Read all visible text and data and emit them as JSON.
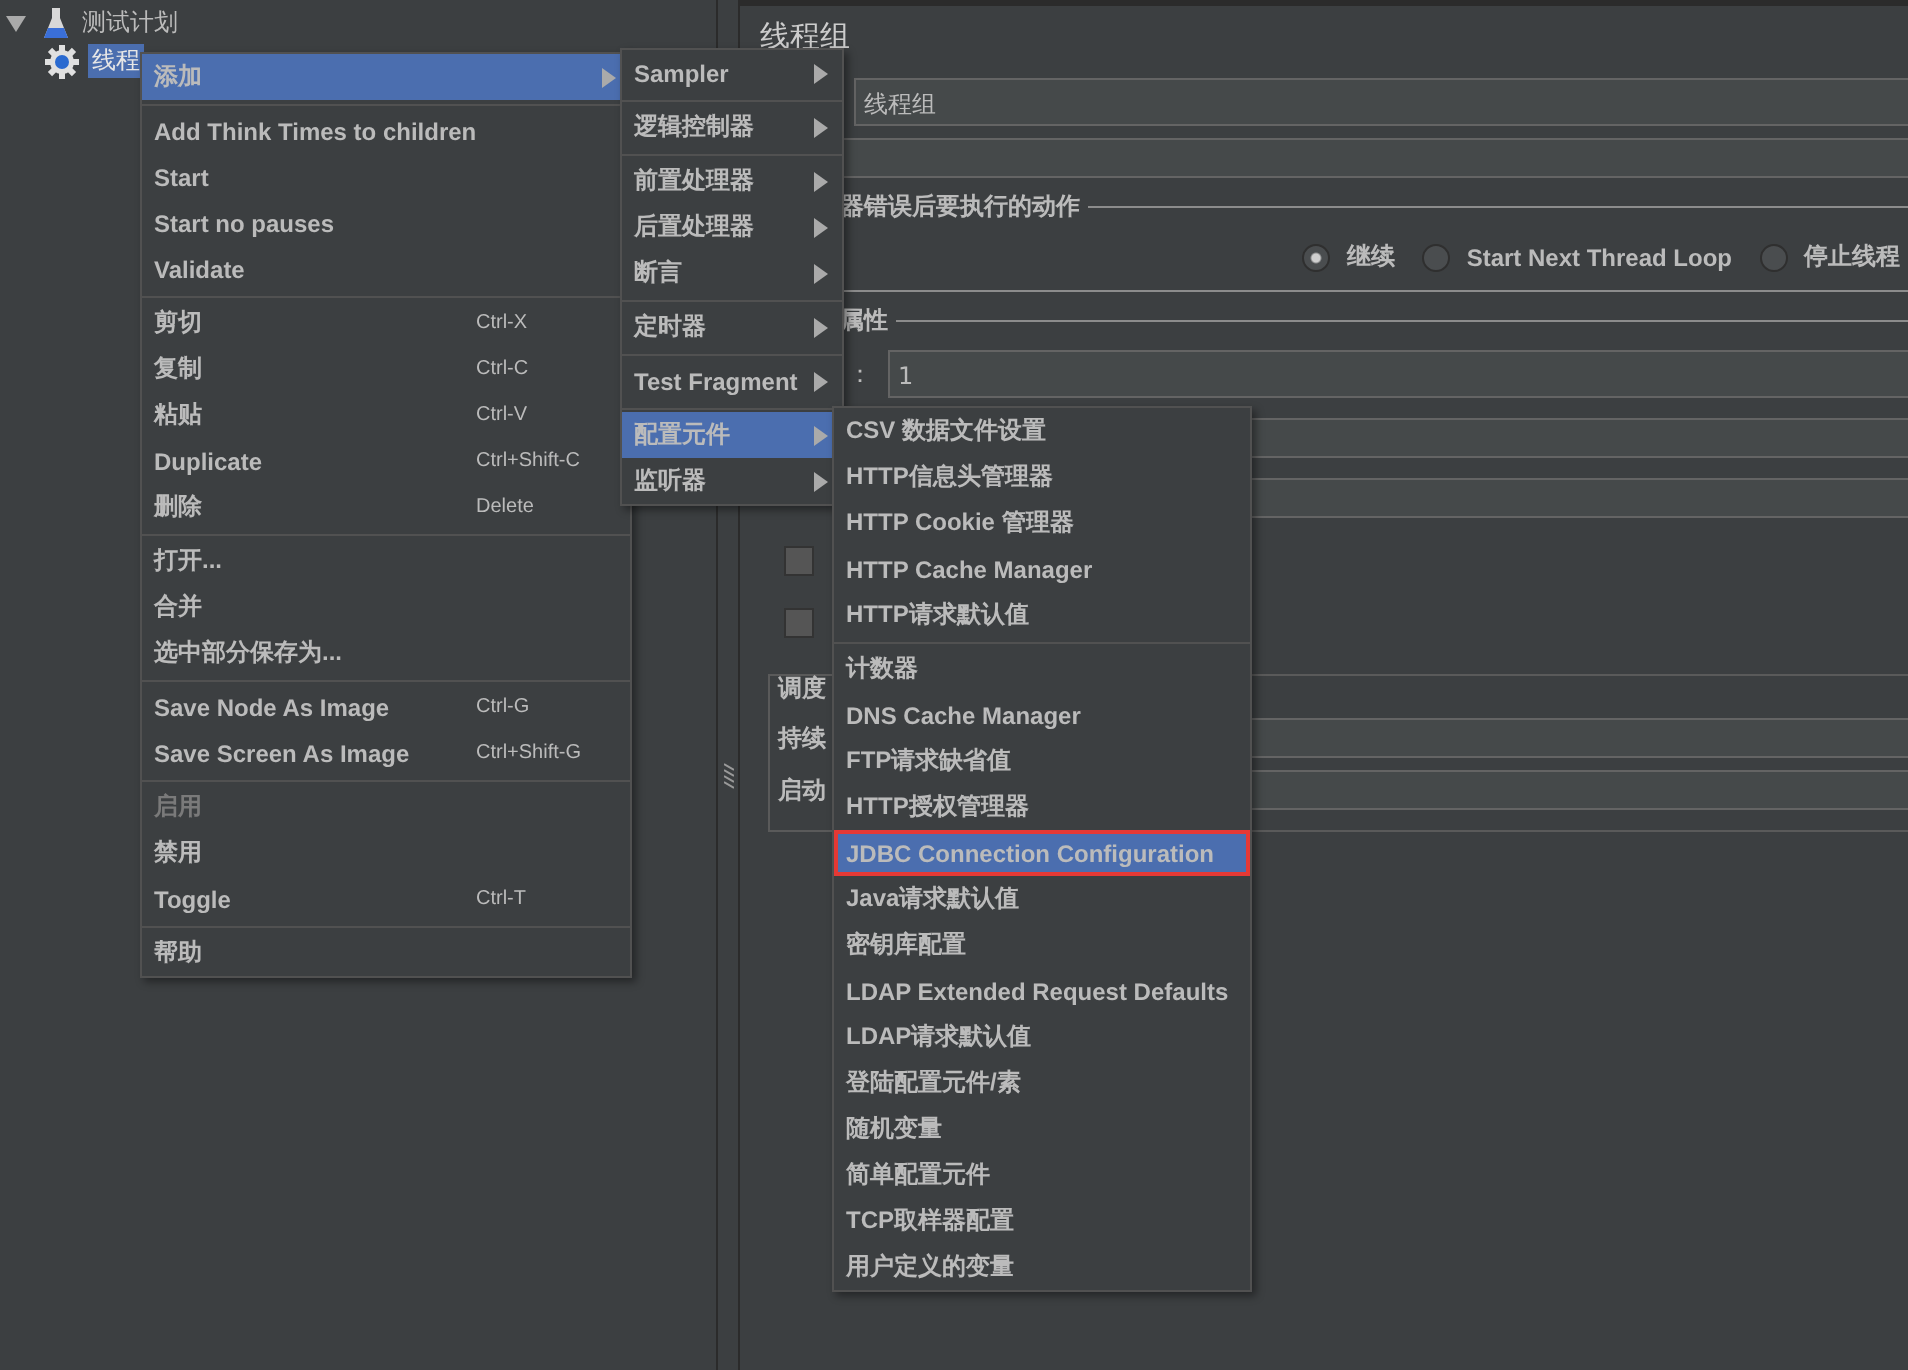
{
  "tree": [
    {
      "label": "测试计划",
      "expanded": true,
      "selected": false,
      "children": [
        {
          "label": "线程",
          "selected": true
        }
      ]
    }
  ],
  "panel": {
    "title": "线程组",
    "name_value": "线程组",
    "error_section": "器错误后要执行的动作",
    "error_actions": [
      {
        "label": "继续",
        "selected": true
      },
      {
        "label": "Start Next Thread Loop",
        "selected": false
      },
      {
        "label": "停止线程",
        "selected": false
      }
    ],
    "props_section": "属性",
    "props_label": "：",
    "threads_value": "1",
    "checkboxes": [
      {
        "checked": false
      },
      {
        "checked": false
      }
    ],
    "sched_section": "调度",
    "sched_labels": [
      "持续",
      "启动"
    ]
  },
  "context_menu": {
    "groups": [
      [
        {
          "label": "添加",
          "submenu": true,
          "selected": true,
          "disabled": false
        }
      ],
      [
        {
          "label": "Add Think Times to children",
          "submenu": false,
          "selected": false,
          "disabled": false
        },
        {
          "label": "Start",
          "submenu": false,
          "selected": false,
          "disabled": false
        },
        {
          "label": "Start no pauses",
          "submenu": false,
          "selected": false,
          "disabled": false
        },
        {
          "label": "Validate",
          "submenu": false,
          "selected": false,
          "disabled": false
        }
      ],
      [
        {
          "label": "剪切",
          "shortcut": "Ctrl-X",
          "submenu": false,
          "selected": false,
          "disabled": false
        },
        {
          "label": "复制",
          "shortcut": "Ctrl-C",
          "submenu": false,
          "selected": false,
          "disabled": false
        },
        {
          "label": "粘贴",
          "shortcut": "Ctrl-V",
          "submenu": false,
          "selected": false,
          "disabled": false
        },
        {
          "label": "Duplicate",
          "shortcut": "Ctrl+Shift-C",
          "submenu": false,
          "selected": false,
          "disabled": false
        },
        {
          "label": "删除",
          "shortcut": "Delete",
          "submenu": false,
          "selected": false,
          "disabled": false
        }
      ],
      [
        {
          "label": "打开...",
          "submenu": false,
          "selected": false,
          "disabled": false
        },
        {
          "label": "合并",
          "submenu": false,
          "selected": false,
          "disabled": false
        },
        {
          "label": "选中部分保存为...",
          "submenu": false,
          "selected": false,
          "disabled": false
        }
      ],
      [
        {
          "label": "Save Node As Image",
          "shortcut": "Ctrl-G",
          "submenu": false,
          "selected": false,
          "disabled": false
        },
        {
          "label": "Save Screen As Image",
          "shortcut": "Ctrl+Shift-G",
          "submenu": false,
          "selected": false,
          "disabled": false
        }
      ],
      [
        {
          "label": "启用",
          "submenu": false,
          "selected": false,
          "disabled": true
        },
        {
          "label": "禁用",
          "submenu": false,
          "selected": false,
          "disabled": false
        },
        {
          "label": "Toggle",
          "shortcut": "Ctrl-T",
          "submenu": false,
          "selected": false,
          "disabled": false
        }
      ],
      [
        {
          "label": "帮助",
          "submenu": false,
          "selected": false,
          "disabled": false
        }
      ]
    ]
  },
  "add_menu": {
    "groups": [
      [
        {
          "label": "Sampler",
          "submenu": true,
          "selected": false
        }
      ],
      [
        {
          "label": "逻辑控制器",
          "submenu": true,
          "selected": false
        }
      ],
      [
        {
          "label": "前置处理器",
          "submenu": true,
          "selected": false
        },
        {
          "label": "后置处理器",
          "submenu": true,
          "selected": false
        },
        {
          "label": "断言",
          "submenu": true,
          "selected": false
        }
      ],
      [
        {
          "label": "定时器",
          "submenu": true,
          "selected": false
        }
      ],
      [
        {
          "label": "Test Fragment",
          "submenu": true,
          "selected": false
        }
      ],
      [
        {
          "label": "配置元件",
          "submenu": true,
          "selected": true
        },
        {
          "label": "监听器",
          "submenu": true,
          "selected": false
        }
      ]
    ]
  },
  "config_menu": {
    "groups": [
      [
        {
          "label": "CSV 数据文件设置",
          "selected": false,
          "annotated": false
        },
        {
          "label": "HTTP信息头管理器",
          "selected": false,
          "annotated": false
        },
        {
          "label": "HTTP Cookie 管理器",
          "selected": false,
          "annotated": false
        },
        {
          "label": "HTTP Cache Manager",
          "selected": false,
          "annotated": false
        },
        {
          "label": "HTTP请求默认值",
          "selected": false,
          "annotated": false
        }
      ],
      [
        {
          "label": "计数器",
          "selected": false,
          "annotated": false
        },
        {
          "label": "DNS Cache Manager",
          "selected": false,
          "annotated": false
        },
        {
          "label": "FTP请求缺省值",
          "selected": false,
          "annotated": false
        },
        {
          "label": "HTTP授权管理器",
          "selected": false,
          "annotated": false
        },
        {
          "label": "JDBC Connection Configuration",
          "selected": true,
          "annotated": true
        },
        {
          "label": "Java请求默认值",
          "selected": false,
          "annotated": false
        },
        {
          "label": "密钥库配置",
          "selected": false,
          "annotated": false
        },
        {
          "label": "LDAP Extended Request Defaults",
          "selected": false,
          "annotated": false
        },
        {
          "label": "LDAP请求默认值",
          "selected": false,
          "annotated": false
        },
        {
          "label": "登陆配置元件/素",
          "selected": false,
          "annotated": false
        },
        {
          "label": "随机变量",
          "selected": false,
          "annotated": false
        },
        {
          "label": "简单配置元件",
          "selected": false,
          "annotated": false
        },
        {
          "label": "TCP取样器配置",
          "selected": false,
          "annotated": false
        },
        {
          "label": "用户定义的变量",
          "selected": false,
          "annotated": false
        }
      ]
    ]
  }
}
